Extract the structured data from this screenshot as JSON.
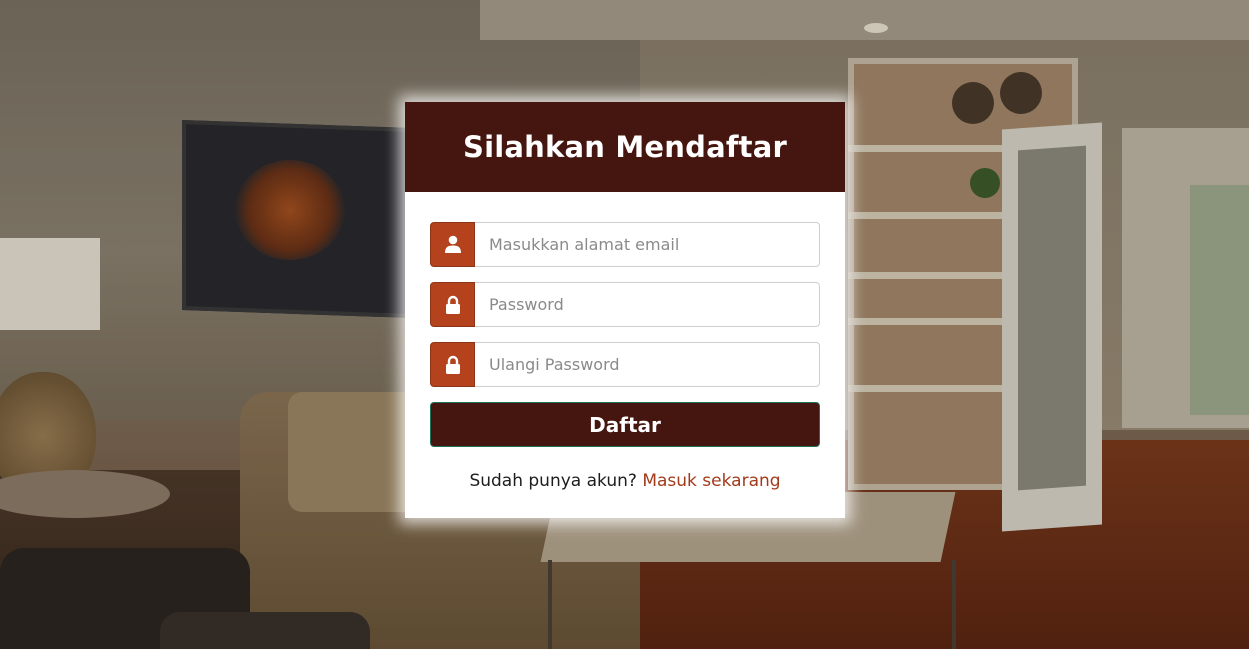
{
  "form": {
    "title": "Silahkan Mendaftar",
    "email": {
      "placeholder": "Masukkan alamat email",
      "value": "",
      "icon": "user-icon"
    },
    "password": {
      "placeholder": "Password",
      "value": "",
      "icon": "lock-icon"
    },
    "password_confirm": {
      "placeholder": "Ulangi Password",
      "value": "",
      "icon": "lock-icon"
    },
    "submit_label": "Daftar",
    "login_prompt": "Sudah punya akun?",
    "login_link": "Masuk sekarang"
  },
  "colors": {
    "header_bg": "#45150f",
    "icon_addon_bg": "#b3421d",
    "button_bg": "#45150f",
    "link": "#a33a1a"
  }
}
